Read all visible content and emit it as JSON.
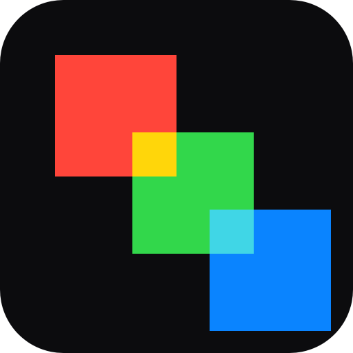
{
  "icon": {
    "name": "overlapping-color-squares",
    "colors": {
      "background": "#0c0c0e",
      "red": "#ff453a",
      "green": "#32d74b",
      "blue": "#0a84ff",
      "red_green_overlap": "#ffd60a",
      "green_blue_overlap": "#40d6e6"
    }
  }
}
